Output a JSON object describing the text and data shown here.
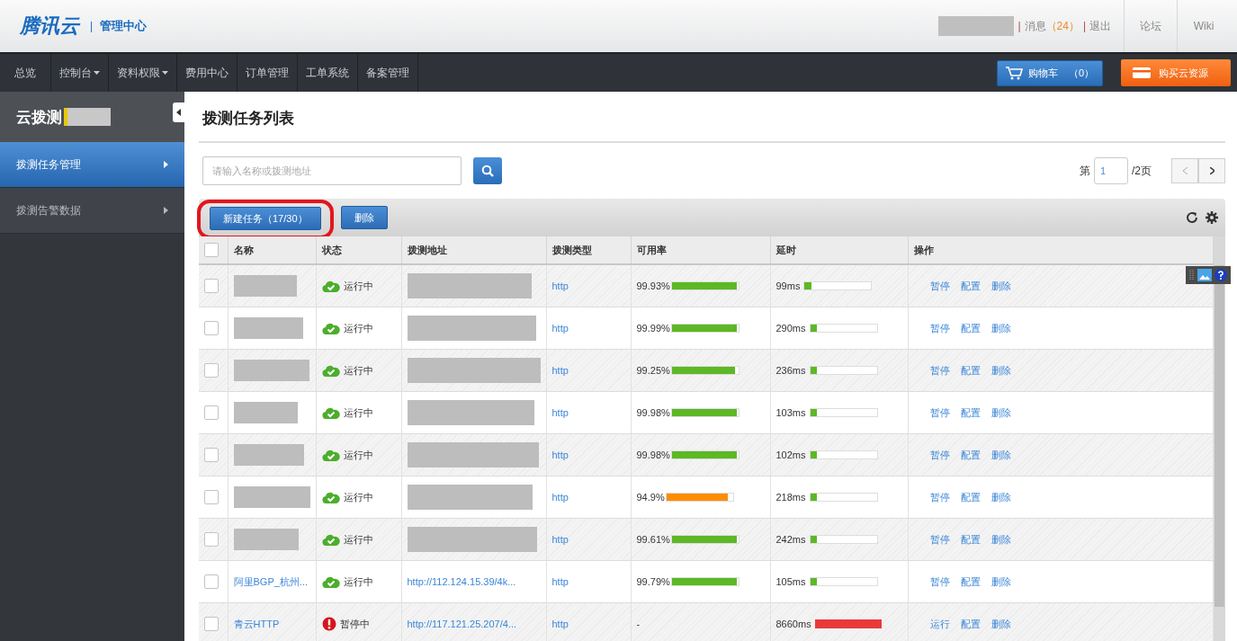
{
  "header": {
    "logo": "腾讯云",
    "dividers": [
      "|",
      "|",
      "|"
    ],
    "subtitle": "管理中心",
    "messages": {
      "label": "消息",
      "count": "（24）"
    },
    "logout": "退出",
    "links": [
      "论坛",
      "Wiki"
    ]
  },
  "nav": {
    "items": [
      {
        "label": "总览",
        "dropdown": false
      },
      {
        "label": "控制台",
        "dropdown": true
      },
      {
        "label": "资料权限",
        "dropdown": true
      },
      {
        "label": "费用中心",
        "dropdown": false
      },
      {
        "label": "订单管理",
        "dropdown": false
      },
      {
        "label": "工单系统",
        "dropdown": false
      },
      {
        "label": "备案管理",
        "dropdown": false
      }
    ],
    "cart": {
      "label": "购物车",
      "count": "（0）"
    },
    "buy": "购买云资源"
  },
  "sidebar": {
    "title": "云拨测",
    "items": [
      {
        "label": "拨测任务管理",
        "selected": true
      },
      {
        "label": "拨测告警数据",
        "selected": false
      }
    ]
  },
  "main": {
    "title": "拨测任务列表",
    "search": {
      "placeholder": "请输入名称或拨测地址"
    },
    "pager": {
      "prefix": "第",
      "page": "1",
      "suffix": "/2页"
    },
    "toolbar": [
      {
        "label": "新建任务（17/30）",
        "highlighted": true
      },
      {
        "label": "删除",
        "highlighted": false
      }
    ],
    "table": {
      "select_all_checked": false,
      "columns": [
        "名称",
        "状态",
        "拨测地址",
        "拨测类型",
        "可用率",
        "延时",
        "操作"
      ],
      "rows": [
        {
          "checked": false,
          "status": {
            "kind": "running",
            "label": "运行中"
          },
          "type": "http",
          "availability": {
            "reading": "99.93%",
            "level": 0.97,
            "color": "#5cb824"
          },
          "latency": {
            "reading": "99ms",
            "level": 0.1,
            "color": "#5cb824"
          },
          "actions": [
            "暂停",
            "配置",
            "删除"
          ]
        },
        {
          "checked": false,
          "status": {
            "kind": "running",
            "label": "运行中"
          },
          "type": "http",
          "availability": {
            "reading": "99.99%",
            "level": 0.97,
            "color": "#5cb824"
          },
          "latency": {
            "reading": "290ms",
            "level": 0.1,
            "color": "#5cb824"
          },
          "actions": [
            "暂停",
            "配置",
            "删除"
          ]
        },
        {
          "checked": false,
          "status": {
            "kind": "running",
            "label": "运行中"
          },
          "type": "http",
          "availability": {
            "reading": "99.25%",
            "level": 0.95,
            "color": "#5cb824"
          },
          "latency": {
            "reading": "236ms",
            "level": 0.1,
            "color": "#5cb824"
          },
          "actions": [
            "暂停",
            "配置",
            "删除"
          ]
        },
        {
          "checked": false,
          "status": {
            "kind": "running",
            "label": "运行中"
          },
          "type": "http",
          "availability": {
            "reading": "99.98%",
            "level": 0.97,
            "color": "#5cb824"
          },
          "latency": {
            "reading": "103ms",
            "level": 0.1,
            "color": "#5cb824"
          },
          "actions": [
            "暂停",
            "配置",
            "删除"
          ]
        },
        {
          "checked": false,
          "status": {
            "kind": "running",
            "label": "运行中"
          },
          "type": "http",
          "availability": {
            "reading": "99.98%",
            "level": 0.97,
            "color": "#5cb824"
          },
          "latency": {
            "reading": "102ms",
            "level": 0.1,
            "color": "#5cb824"
          },
          "actions": [
            "暂停",
            "配置",
            "删除"
          ]
        },
        {
          "checked": false,
          "status": {
            "kind": "running",
            "label": "运行中"
          },
          "type": "http",
          "availability": {
            "reading": "94.9%",
            "level": 0.92,
            "color": "#ff8c00"
          },
          "latency": {
            "reading": "218ms",
            "level": 0.1,
            "color": "#5cb824"
          },
          "actions": [
            "暂停",
            "配置",
            "删除"
          ]
        },
        {
          "checked": false,
          "status": {
            "kind": "running",
            "label": "运行中"
          },
          "type": "http",
          "availability": {
            "reading": "99.61%",
            "level": 0.97,
            "color": "#5cb824"
          },
          "latency": {
            "reading": "242ms",
            "level": 0.1,
            "color": "#5cb824"
          },
          "actions": [
            "暂停",
            "配置",
            "删除"
          ]
        },
        {
          "checked": false,
          "name": "阿里BGP_杭州...",
          "address": "http://112.124.15.39/4k...",
          "status": {
            "kind": "running",
            "label": "运行中"
          },
          "type": "http",
          "availability": {
            "reading": "99.79%",
            "level": 0.97,
            "color": "#5cb824"
          },
          "latency": {
            "reading": "105ms",
            "level": 0.1,
            "color": "#5cb824"
          },
          "actions": [
            "暂停",
            "配置",
            "删除"
          ]
        },
        {
          "checked": false,
          "name": "青云HTTP",
          "address": "http://117.121.25.207/4...",
          "status": {
            "kind": "paused",
            "label": "暂停中"
          },
          "type": "http",
          "availability": {
            "reading": "-"
          },
          "latency": {
            "reading": "8660ms",
            "level": 1,
            "color": "#e83a3a"
          },
          "actions": [
            "运行",
            "配置",
            "删除"
          ]
        }
      ]
    }
  }
}
